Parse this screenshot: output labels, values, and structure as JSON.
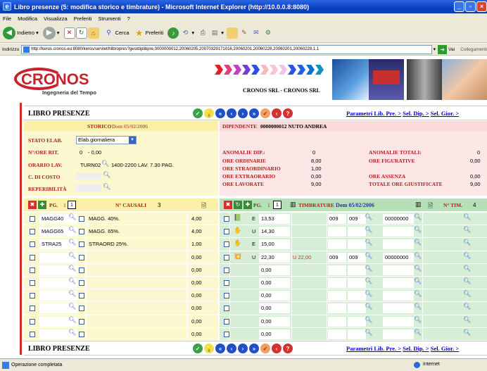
{
  "window": {
    "title": "Libro presenze (5: modifica storico e timbrature) - Microsoft Internet Explorer (http://10.0.0.8:8080)"
  },
  "menu": [
    "File",
    "Modifica",
    "Visualizza",
    "Preferiti",
    "Strumenti",
    "?"
  ],
  "toolbar": {
    "back": "Indietro",
    "search": "Cerca",
    "favorites": "Preferiti"
  },
  "address": {
    "label": "Indirizzo",
    "url": "http://keros.cronos.eu:8080/keros/servlet/hlibropres?gestdiplibpre,0000000012,20060205,20070329171016,20060201,20060228,20060201,20060228,1,1",
    "go": "Vai",
    "links": "Collegamenti"
  },
  "banner": {
    "logo": "CRONOS",
    "tagline": "Ingegneria del Tempo",
    "company": "CRONOS SRL - CRONOS SRL"
  },
  "header": {
    "title": "LIBRO PRESENZE",
    "link1": "Parametri Lib. Pre. >",
    "link2": "Sel. Dip. >",
    "link3": "Sel. Gior. >"
  },
  "left": {
    "storico_label": "STORICO",
    "storico_value": "Dom  05/02/2006",
    "stato_label": "STATO ELAB.",
    "stato_value": "Elab.giornaliera",
    "ore_rit_label": "N°/ORE RIT.",
    "ore_rit_n": "0",
    "ore_rit_value": "- 0,00",
    "orario_label": "ORARIO LAV.",
    "orario_code": "TURN02",
    "orario_desc": "1400-2200 LAV. 7.30 PAG.",
    "costo_label": "C. DI COSTO",
    "reper_label": "REPERIBILITÀ"
  },
  "right": {
    "dip_label": "DIPENDENTE",
    "dip_value": "0000000012  NUTO ANDREA",
    "anom_dip_label": "ANOMALIE DIP.:",
    "anom_dip_value": "0",
    "anom_tot_label": "ANOMALIE TOTALI:",
    "anom_tot_value": "0",
    "ore_ord_label": "ORE ORDINARIE",
    "ore_ord_value": "8,00",
    "ore_fig_label": "ORE FIGURATIVE",
    "ore_fig_value": "0,00",
    "ore_str_label": "ORE STRAORDINARIO",
    "ore_str_value": "1,00",
    "ore_ext_label": "ORE EXTRAORARIO",
    "ore_ext_value": "0,00",
    "ore_ass_label": "ORE ASSENZA",
    "ore_ass_value": "0,00",
    "ore_lav_label": "ORE LAVORATE",
    "ore_lav_value": "9,00",
    "tot_giust_label": "TOTALE ORE GIUSTIFICATE",
    "tot_giust_value": "9,00"
  },
  "causali": {
    "pg_label": "PG.",
    "pg_value": "1",
    "count_label": "N° CAUSALI",
    "count_value": "3",
    "rows": [
      {
        "code": "MAGG40",
        "desc": "MAGG. 40%.",
        "value": "4,00"
      },
      {
        "code": "MAGG65",
        "desc": "MAGG. 65%.",
        "value": "4,00"
      },
      {
        "code": "STRA25",
        "desc": "STRAORD 25%.",
        "value": "1,00"
      },
      {
        "code": "",
        "desc": "",
        "value": "0,00"
      },
      {
        "code": "",
        "desc": "",
        "value": "0,00"
      },
      {
        "code": "",
        "desc": "",
        "value": "0,00"
      },
      {
        "code": "",
        "desc": "",
        "value": "0,00"
      },
      {
        "code": "",
        "desc": "",
        "value": "0,00"
      },
      {
        "code": "",
        "desc": "",
        "value": "0,00"
      },
      {
        "code": "",
        "desc": "",
        "value": "0,00"
      }
    ]
  },
  "timbrature": {
    "pg_label": "PG.",
    "pg_value": "1",
    "title": "TIMBRATURE",
    "date": "Dom  05/02/2006",
    "count_label": "N° TIM.",
    "count_value": "4",
    "rows": [
      {
        "dir": "E",
        "time": "13,53",
        "rtime": "",
        "c1": "009",
        "c2": "009",
        "code": "00000000"
      },
      {
        "dir": "U",
        "time": "14,30",
        "rtime": "",
        "c1": "",
        "c2": "",
        "code": ""
      },
      {
        "dir": "E",
        "time": "15,00",
        "rtime": "",
        "c1": "",
        "c2": "",
        "code": ""
      },
      {
        "dir": "U",
        "time": "22,30",
        "rtime": "U 22,00",
        "c1": "009",
        "c2": "009",
        "code": "00000000"
      },
      {
        "dir": "",
        "time": "0,00",
        "rtime": "",
        "c1": "",
        "c2": "",
        "code": ""
      },
      {
        "dir": "",
        "time": "0,00",
        "rtime": "",
        "c1": "",
        "c2": "",
        "code": ""
      },
      {
        "dir": "",
        "time": "0,00",
        "rtime": "",
        "c1": "",
        "c2": "",
        "code": ""
      },
      {
        "dir": "",
        "time": "0,00",
        "rtime": "",
        "c1": "",
        "c2": "",
        "code": ""
      },
      {
        "dir": "",
        "time": "0,00",
        "rtime": "",
        "c1": "",
        "c2": "",
        "code": ""
      },
      {
        "dir": "",
        "time": "0,00",
        "rtime": "",
        "c1": "",
        "c2": "",
        "code": ""
      }
    ]
  },
  "status": {
    "text": "Operazione completata",
    "zone": "Internet"
  },
  "colors": {
    "accent_red": "#b41c1c",
    "left_bg": "#fbf7cf",
    "right_bg": "#fce6e6",
    "left_row": "#fbf7cf",
    "right_row": "#d6eed6"
  }
}
